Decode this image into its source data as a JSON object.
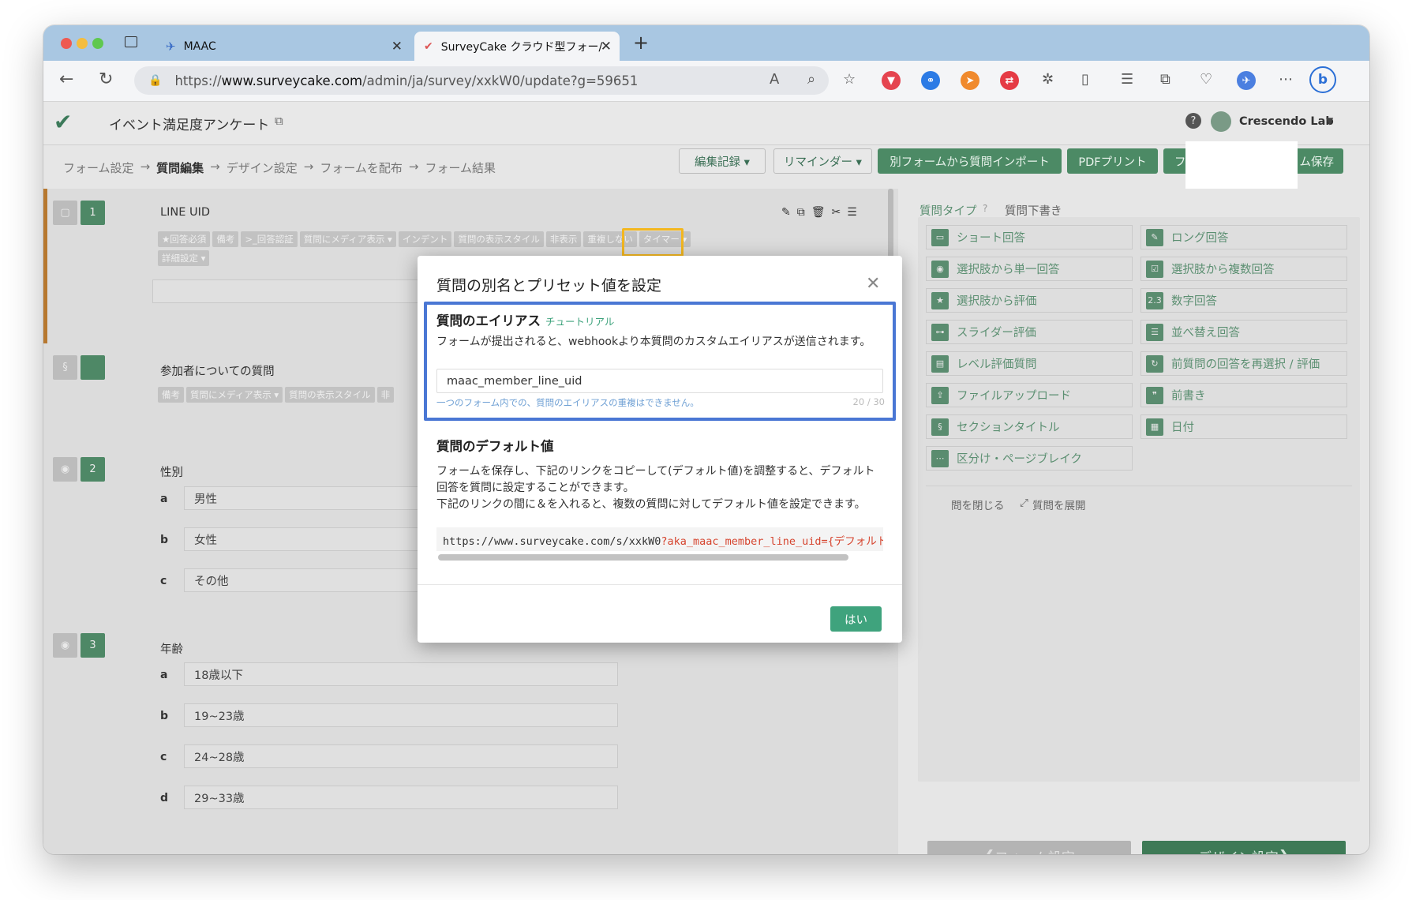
{
  "browser": {
    "tabs": [
      {
        "title": "MAAC"
      },
      {
        "title": "SurveyCake クラウド型フォー/"
      }
    ],
    "url_prefix": "https://",
    "url_domain": "www.surveycake.com",
    "url_path": "/admin/ja/survey/xxkW0/update?g=59651"
  },
  "app": {
    "survey_title": "イベント満足度アンケート",
    "account": "Crescendo Lab",
    "breadcrumb": [
      "フォーム設定",
      "質問編集",
      "デザイン設定",
      "フォームを配布",
      "フォーム結果"
    ],
    "arrow": "→",
    "toolbar": {
      "edit_log": "編集記録 ▾",
      "reminder": "リマインダー ▾",
      "import": "別フォームから質問インポート",
      "pdf": "PDFプリント",
      "preview": "フ",
      "save": "ム保存"
    }
  },
  "questions": [
    {
      "num": "1",
      "title": "LINE UID",
      "chips": [
        "★回答必須",
        "備考",
        ">_回答認証",
        "質問にメディア表示 ▾",
        "インデント",
        "質問の表示スタイル",
        "非表示",
        "重複しない",
        "タイマー ▾"
      ],
      "chip_adv": "詳細設定 ▾"
    },
    {
      "num": "§",
      "title": "参加者についての質問",
      "chips": [
        "備考",
        "質問にメディア表示 ▾",
        "質問の表示スタイル",
        "非"
      ]
    },
    {
      "num": "2",
      "title": "性別",
      "options": [
        {
          "label": "a",
          "text": "男性"
        },
        {
          "label": "b",
          "text": "女性"
        },
        {
          "label": "c",
          "text": "その他"
        }
      ]
    },
    {
      "num": "3",
      "title": "年齢",
      "options": [
        {
          "label": "a",
          "text": "18歳以下"
        },
        {
          "label": "b",
          "text": "19~23歳"
        },
        {
          "label": "c",
          "text": "24~28歳"
        },
        {
          "label": "d",
          "text": "29~33歳"
        }
      ]
    }
  ],
  "sidebar": {
    "tab_types": "質問タイプ",
    "tab_draft": "質問下書き",
    "types": [
      "ショート回答",
      "ロング回答",
      "選択肢から単一回答",
      "選択肢から複数回答",
      "選択肢から評価",
      "数字回答",
      "スライダー評価",
      "並べ替え回答",
      "レベル評価質問",
      "前質問の回答を再選択 / 評価",
      "ファイルアップロード",
      "前書き",
      "セクションタイトル",
      "日付",
      "区分け・ページブレイク"
    ],
    "collapse": "問を閉じる",
    "expand": "質問を展開",
    "prev_step": "フォーム設定",
    "next_step": "デザイン設定"
  },
  "modal": {
    "title": "質問の別名とプリセット値を設定",
    "alias_heading": "質問のエイリアス",
    "tutorial": "チュートリアル",
    "alias_desc": "フォームが提出されると、webhookより本質問のカスタムエイリアスが送信されます。",
    "alias_value": "maac_member_line_uid",
    "alias_hint": "一つのフォーム内での、質問のエイリアスの重複はできません。",
    "alias_count": "20 / 30",
    "default_heading": "質問のデフォルト値",
    "default_desc1": "フォームを保存し、下記のリンクをコピーして(デフォルト値)を調整すると、デフォルト回答を質問に設定することができます。",
    "default_desc2": "下記のリンクの間に＆を入れると、複数の質問に対してデフォルト値を設定できます。",
    "link_base": "https://www.surveycake.com/s/xxkW0",
    "link_param": "?aka_maac_member_line_uid={デフォルト値}",
    "ok": "はい"
  }
}
